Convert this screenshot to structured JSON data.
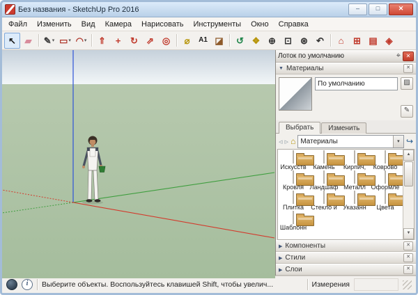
{
  "window": {
    "title": "Без названия - SketchUp Pro 2016",
    "controls": {
      "minimize": "–",
      "maximize": "□",
      "close": "✕"
    }
  },
  "menu": {
    "items": [
      "Файл",
      "Изменить",
      "Вид",
      "Камера",
      "Нарисовать",
      "Инструменты",
      "Окно",
      "Справка"
    ]
  },
  "toolbar": {
    "tools": [
      {
        "name": "select",
        "glyph": "↖",
        "color": "#1a1a1a",
        "active": true
      },
      {
        "name": "eraser",
        "glyph": "▰",
        "color": "#d88b9b"
      },
      {
        "sep": true
      },
      {
        "name": "line",
        "glyph": "✎",
        "color": "#3a3a3a",
        "dropdown": true
      },
      {
        "name": "shapes",
        "glyph": "▭",
        "color": "#b03a2e",
        "dropdown": true
      },
      {
        "name": "arc",
        "glyph": "◠",
        "color": "#b03a2e",
        "dropdown": true
      },
      {
        "sep": true
      },
      {
        "name": "push-pull",
        "glyph": "⇑",
        "color": "#c0392b"
      },
      {
        "name": "move",
        "glyph": "+",
        "color": "#c0392b"
      },
      {
        "name": "rotate",
        "glyph": "↻",
        "color": "#c0392b"
      },
      {
        "name": "scale",
        "glyph": "⇗",
        "color": "#c0392b"
      },
      {
        "name": "offset",
        "glyph": "◎",
        "color": "#c0392b"
      },
      {
        "sep": true
      },
      {
        "name": "tape-measure",
        "glyph": "⌀",
        "color": "#b7950b"
      },
      {
        "name": "text",
        "glyph": "A1",
        "color": "#1a1a1a"
      },
      {
        "name": "paint-bucket",
        "glyph": "◪",
        "color": "#8e5a2a"
      },
      {
        "sep": true
      },
      {
        "name": "orbit",
        "glyph": "↺",
        "color": "#1e8449"
      },
      {
        "name": "pan",
        "glyph": "❖",
        "color": "#b7950b"
      },
      {
        "name": "zoom",
        "glyph": "⊕",
        "color": "#333333"
      },
      {
        "name": "zoom-window",
        "glyph": "⊡",
        "color": "#333333"
      },
      {
        "name": "zoom-extents",
        "glyph": "⊛",
        "color": "#333333"
      },
      {
        "name": "previous",
        "glyph": "↶",
        "color": "#333333"
      },
      {
        "sep": true
      },
      {
        "name": "3d-warehouse",
        "glyph": "⌂",
        "color": "#c0392b"
      },
      {
        "name": "extension-warehouse",
        "glyph": "⊞",
        "color": "#c0392b"
      },
      {
        "name": "layout",
        "glyph": "▤",
        "color": "#c0392b"
      },
      {
        "name": "styles",
        "glyph": "◈",
        "color": "#c0392b"
      }
    ]
  },
  "viewport": {
    "sky_top": "#c6d1db",
    "sky_horizon": "#f2f6f8",
    "ground_far": "#b7c9ae",
    "ground_near": "#a5bd9d",
    "axis_colors": {
      "red": "#d33a2c",
      "green": "#3f9e3f",
      "blue": "#2e53d8"
    }
  },
  "tray": {
    "title": "Лоток по умолчанию",
    "materials": {
      "title": "Материалы",
      "material_name": "По умолчанию",
      "tabs": [
        "Выбрать",
        "Изменить"
      ],
      "active_tab": "Выбрать",
      "collection": "Материалы",
      "categories": [
        "Искусств",
        "Камень",
        "Кирпич,",
        "Коврово",
        "Кровля",
        "Ландшаф",
        "Металл",
        "Оформле",
        "Плитка",
        "Стекло и",
        "Указанн",
        "Цвета",
        "Шаблонн"
      ]
    },
    "sections": [
      "Компоненты",
      "Стили",
      "Слои"
    ]
  },
  "statusbar": {
    "message": "Выберите объекты. Воспользуйтесь клавишей Shift, чтобы увелич...",
    "measurements_label": "Измерения"
  },
  "icons": {
    "pin": "⌖",
    "close": "✕",
    "section_expanded": "▼",
    "section_collapsed": "▶",
    "back": "◃",
    "forward": "▹",
    "home": "⌂",
    "details": "↪",
    "create_material": "▨",
    "sample_paint": "✎",
    "dropdown": "▾",
    "scroll_up": "▲",
    "scroll_down": "▼",
    "info": "i"
  }
}
